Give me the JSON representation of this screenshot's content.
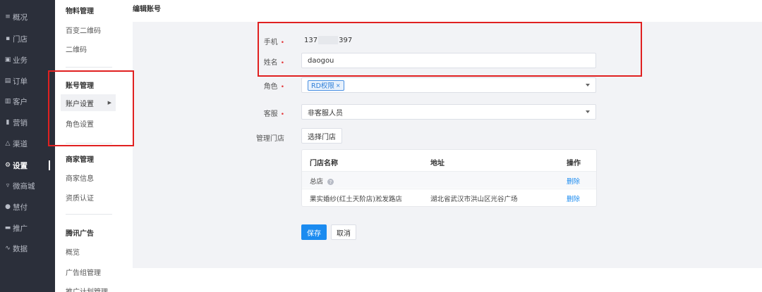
{
  "nav": {
    "items": [
      {
        "icon": "list-icon",
        "glyph": "≡",
        "label": "概况"
      },
      {
        "icon": "store-icon",
        "glyph": "▪",
        "label": "门店"
      },
      {
        "icon": "briefcase-icon",
        "glyph": "▣",
        "label": "业务"
      },
      {
        "icon": "order-icon",
        "glyph": "▤",
        "label": "订单"
      },
      {
        "icon": "customer-icon",
        "glyph": "▥",
        "label": "客户"
      },
      {
        "icon": "bar-chart-icon",
        "glyph": "▮",
        "label": "营销"
      },
      {
        "icon": "channel-icon",
        "glyph": "△",
        "label": "渠道"
      },
      {
        "icon": "gear-icon",
        "glyph": "⚙",
        "label": "设置",
        "active": true
      },
      {
        "icon": "mall-icon",
        "glyph": "▿",
        "label": "微商城"
      },
      {
        "icon": "payment-icon",
        "glyph": "●",
        "label": "慧付"
      },
      {
        "icon": "promo-icon",
        "glyph": "▬",
        "label": "推广"
      },
      {
        "icon": "data-icon",
        "glyph": "∿",
        "label": "数据"
      }
    ]
  },
  "submenu": {
    "group_material": "物料管理",
    "item_qrcode_variety": "百变二维码",
    "item_qrcode": "二维码",
    "group_account": "账号管理",
    "item_account_settings": "账户设置",
    "item_role_settings": "角色设置",
    "group_merchant": "商家管理",
    "item_merchant_info": "商家信息",
    "item_qualification": "资质认证",
    "group_tencent_ads": "腾讯广告",
    "item_overview": "概览",
    "item_adgroup_mgmt": "广告组管理",
    "item_promo_plan_mgmt": "推广计划管理"
  },
  "page": {
    "title": "编辑账号"
  },
  "form": {
    "phone_label": "手机",
    "phone_prefix": "137",
    "phone_suffix": "397",
    "name_label": "姓名",
    "name_value": "daogou",
    "role_label": "角色",
    "role_tag": "RD权限",
    "role_tag_remove": "×",
    "service_label": "客服",
    "service_value": "非客服人员",
    "stores_label": "管理门店",
    "select_store_button": "选择门店",
    "required_mark": "•"
  },
  "store_table": {
    "columns": [
      "门店名称",
      "地址",
      "操作"
    ],
    "rows": [
      {
        "name": "总店",
        "address": "",
        "action": "删除",
        "help": "?"
      },
      {
        "name": "果实婚纱(红土天阶店)淞发路店",
        "address": "湖北省武汉市洪山区光谷广场",
        "action": "删除"
      }
    ]
  },
  "actions": {
    "save": "保存",
    "cancel": "取消"
  },
  "colors": {
    "nav_bg": "#2b2f3a",
    "primary": "#1b8bf0",
    "annotation_red": "#e02020",
    "required_red": "#e4393c"
  }
}
